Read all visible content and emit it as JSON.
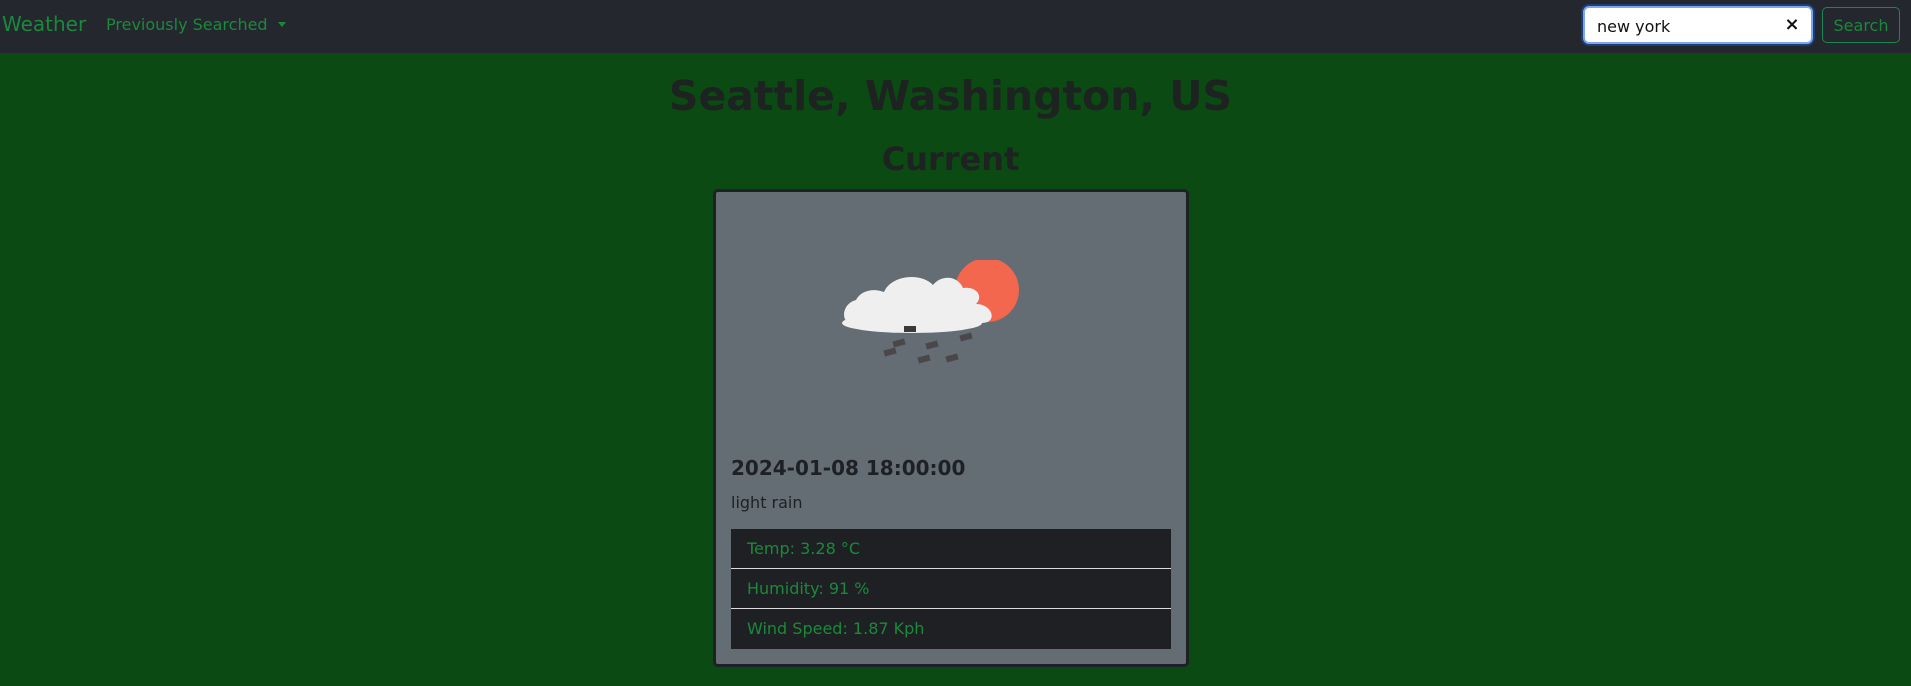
{
  "navbar": {
    "brand": "Weather",
    "dropdown_label": "Previously Searched",
    "search": {
      "value": "new york",
      "placeholder": "",
      "button_label": "Search"
    }
  },
  "location": {
    "title": "Seattle, Washington, US",
    "section": "Current"
  },
  "current": {
    "icon": "light-rain-icon",
    "date": "2024-01-08 18:00:00",
    "description": "light rain",
    "stats": [
      {
        "text": "Temp: 3.28 °C"
      },
      {
        "text": "Humidity: 91 %"
      },
      {
        "text": "Wind Speed: 1.87 Kph"
      }
    ]
  },
  "colors": {
    "page_background": "#0b4a13",
    "navbar_background": "#24272d",
    "accent_green": "#198a3a",
    "card_background": "#646c74",
    "stat_background": "#1e2024"
  }
}
